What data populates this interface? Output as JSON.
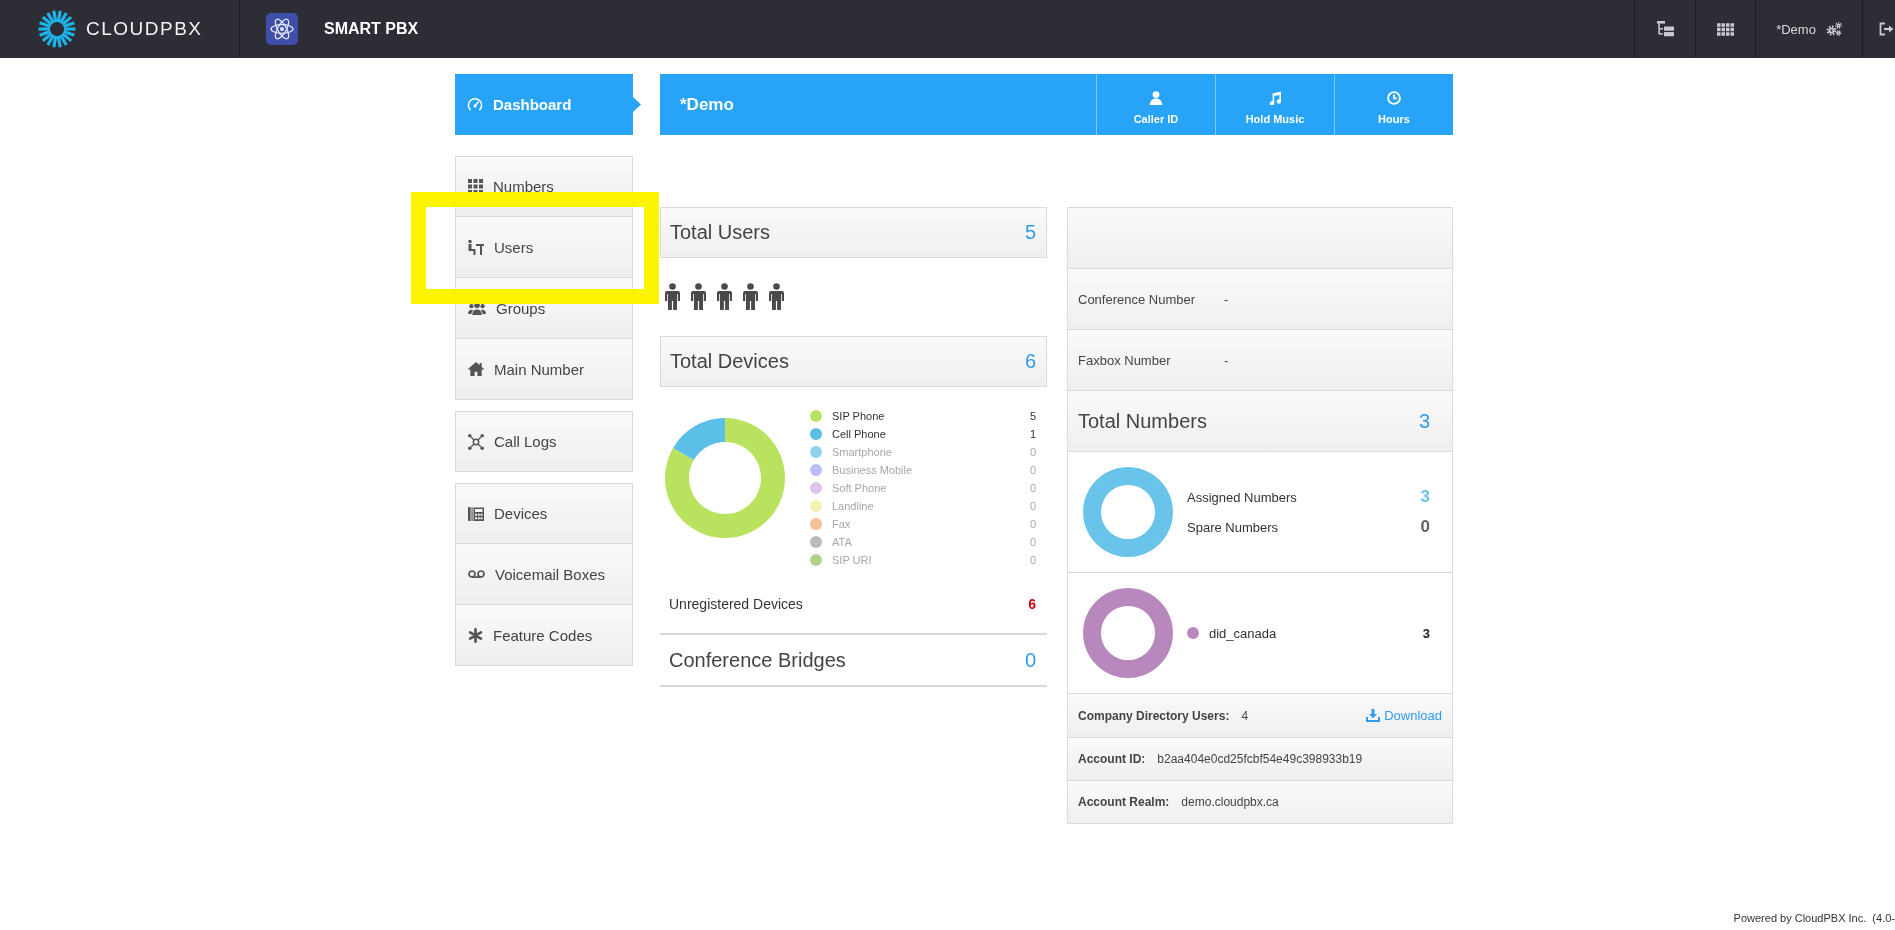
{
  "topbar": {
    "logo": "CLOUDPBX",
    "app_name": "SMART PBX",
    "account": "*Demo"
  },
  "sidebar": {
    "groups": [
      {
        "items": [
          {
            "label": "Dashboard",
            "selected": true,
            "highlighted": false
          }
        ]
      },
      {
        "items": [
          {
            "label": "Numbers",
            "selected": false,
            "highlighted": false
          },
          {
            "label": "Users",
            "selected": false,
            "highlighted": true
          },
          {
            "label": "Groups",
            "selected": false,
            "highlighted": false
          },
          {
            "label": "Main Number",
            "selected": false,
            "highlighted": false
          }
        ]
      },
      {
        "items": [
          {
            "label": "Call Logs",
            "selected": false,
            "highlighted": false
          }
        ]
      },
      {
        "items": [
          {
            "label": "Devices",
            "selected": false,
            "highlighted": false
          },
          {
            "label": "Voicemail Boxes",
            "selected": false,
            "highlighted": false
          },
          {
            "label": "Feature Codes",
            "selected": false,
            "highlighted": false
          }
        ]
      }
    ]
  },
  "header": {
    "title": "*Demo",
    "actions": [
      {
        "label": "Caller ID"
      },
      {
        "label": "Hold Music"
      },
      {
        "label": "Hours"
      }
    ]
  },
  "users": {
    "title": "Total Users",
    "total": "5"
  },
  "devices": {
    "title": "Total Devices",
    "total": "6",
    "chart_data": {
      "type": "donut",
      "categories": [
        "SIP Phone",
        "Cell Phone",
        "Smartphone",
        "Business Mobile",
        "Soft Phone",
        "Landline",
        "Fax",
        "ATA",
        "SIP URI"
      ],
      "values": [
        83.33,
        16.67,
        0,
        0,
        0,
        0,
        0,
        0,
        0
      ]
    },
    "legend": [
      {
        "color": "#b9e25f",
        "count": "5",
        "muted": false
      },
      {
        "color": "#5bbfe8",
        "count": "1",
        "muted": false
      },
      {
        "color": "#8fd2ee",
        "count": "0",
        "muted": true
      },
      {
        "color": "#b9bff4",
        "count": "0",
        "muted": true
      },
      {
        "color": "#dcc5e6",
        "count": "0",
        "muted": true
      },
      {
        "color": "#f6efb6",
        "count": "0",
        "muted": true
      },
      {
        "color": "#f5c29a",
        "count": "0",
        "muted": true
      },
      {
        "color": "#b8bcbe",
        "count": "0",
        "muted": true
      },
      {
        "color": "#b4d08f",
        "count": "0",
        "muted": true
      }
    ],
    "unregistered": {
      "label": "Unregistered Devices",
      "value": "6"
    }
  },
  "conference_bridges": {
    "title": "Conference Bridges",
    "total": "0"
  },
  "account_panel": {
    "rows": [
      {
        "label": "Conference Number",
        "value": "-"
      },
      {
        "label": "Faxbox Number",
        "value": "-"
      }
    ],
    "numbers": {
      "title": "Total Numbers",
      "total": "3",
      "legend": [
        {
          "label": "Assigned Numbers",
          "count": "3",
          "color": "#6ac4ea"
        },
        {
          "label": "Spare Numbers",
          "count": "0",
          "color": "#5f6469"
        }
      ]
    },
    "number_types": {
      "legend": [
        {
          "label": "did_canada",
          "count": "3",
          "color": "#b887bd"
        }
      ]
    },
    "info": [
      {
        "label": "Company Directory Users:",
        "value": "4",
        "link": "Download"
      },
      {
        "label": "Account ID:",
        "value": "b2aa404e0cd25fcbf54e49c398933b19"
      },
      {
        "label": "Account Realm:",
        "value": "demo.cloudpbx.ca"
      }
    ]
  },
  "footer": "Powered by CloudPBX Inc.  (4.0-"
}
